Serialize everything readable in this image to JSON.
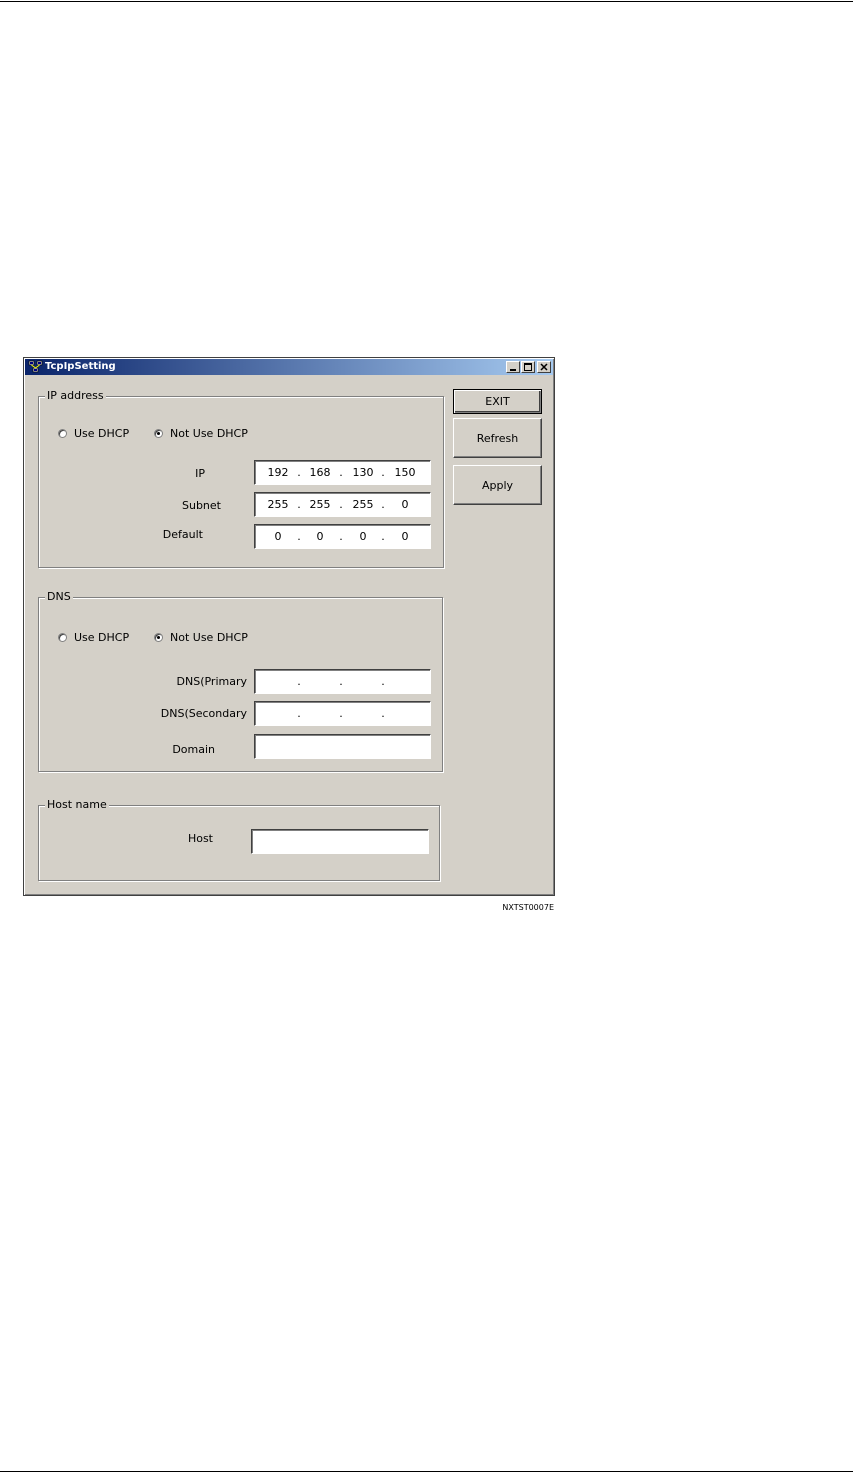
{
  "window": {
    "title": "TcpIpSetting",
    "title_icon": "network-computers-icon",
    "controls": {
      "minimize": "minimize-icon",
      "maximize": "maximize-icon",
      "close": "close-icon"
    }
  },
  "buttons": {
    "exit": "EXIT",
    "refresh": "Refresh",
    "apply": "Apply"
  },
  "ip_group": {
    "title": "IP address",
    "radio_use_dhcp": "Use DHCP",
    "radio_not_use_dhcp": "Not Use DHCP",
    "selected": "Not Use DHCP",
    "ip_label": "IP",
    "ip": [
      "192",
      "168",
      "130",
      "150"
    ],
    "subnet_label": "Subnet",
    "subnet": [
      "255",
      "255",
      "255",
      "0"
    ],
    "default_label": "Default",
    "default": [
      "0",
      "0",
      "0",
      "0"
    ]
  },
  "dns_group": {
    "title": "DNS",
    "radio_use_dhcp": "Use DHCP",
    "radio_not_use_dhcp": "Not Use DHCP",
    "selected": "Not Use DHCP",
    "primary_label": "DNS(Primary",
    "primary": [
      "",
      "",
      "",
      ""
    ],
    "secondary_label": "DNS(Secondary",
    "secondary": [
      "",
      "",
      "",
      ""
    ],
    "domain_label": "Domain",
    "domain_value": ""
  },
  "host_group": {
    "title": "Host name",
    "host_label": "Host",
    "host_value": ""
  },
  "dot": ".",
  "figure_id": "NXTST0007E"
}
